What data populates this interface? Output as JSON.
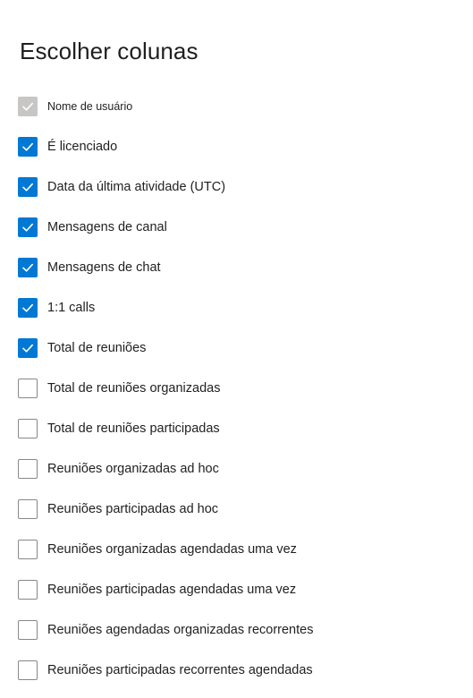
{
  "panel": {
    "title": "Escolher colunas"
  },
  "accent_color": "#0078d4",
  "columns": [
    {
      "label": "Nome de usuário",
      "state": "disabled"
    },
    {
      "label": "É licenciado",
      "state": "checked"
    },
    {
      "label": "Data da última atividade (UTC)",
      "state": "checked"
    },
    {
      "label": "Mensagens de canal",
      "state": "checked"
    },
    {
      "label": "Mensagens de chat",
      "state": "checked"
    },
    {
      "label": "1:1 calls",
      "state": "checked"
    },
    {
      "label": "Total de reuniões",
      "state": "checked"
    },
    {
      "label": "Total de reuniões organizadas",
      "state": "unchecked"
    },
    {
      "label": "Total de reuniões participadas",
      "state": "unchecked"
    },
    {
      "label": "Reuniões organizadas ad hoc",
      "state": "unchecked"
    },
    {
      "label": "Reuniões participadas ad hoc",
      "state": "unchecked"
    },
    {
      "label": "Reuniões organizadas agendadas uma vez",
      "state": "unchecked"
    },
    {
      "label": "Reuniões participadas agendadas uma vez",
      "state": "unchecked"
    },
    {
      "label": "Reuniões agendadas organizadas recorrentes",
      "state": "unchecked"
    },
    {
      "label": "Reuniões participadas recorrentes agendadas",
      "state": "unchecked"
    }
  ]
}
